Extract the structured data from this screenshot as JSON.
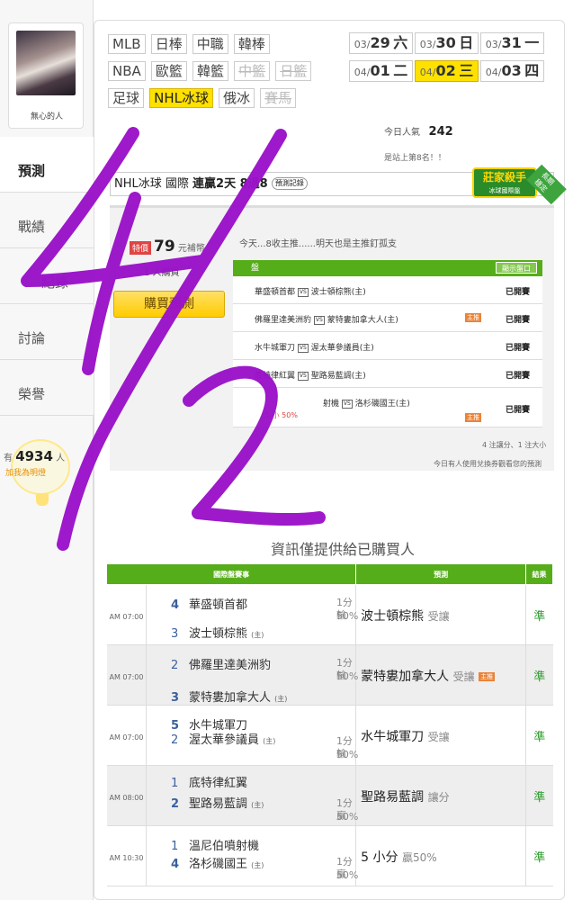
{
  "sidebar": {
    "username": "無心的人",
    "menu": [
      "預測",
      "戰績",
      "紀錄",
      "討論",
      "榮譽"
    ],
    "counter_prefix": "有",
    "counter_value": "4934",
    "counter_unit": "人",
    "counter_sub": "加我為明燈"
  },
  "filters": {
    "row1": [
      "MLB",
      "日棒",
      "中職",
      "韓棒"
    ],
    "row2": [
      "NBA",
      "歐籃",
      "韓籃",
      "中籃",
      "日籃"
    ],
    "row3": [
      "足球",
      "NHL冰球",
      "俄冰",
      "賽馬"
    ]
  },
  "dates": [
    {
      "md": "03/",
      "d": "29",
      "w": "六"
    },
    {
      "md": "03/",
      "d": "30",
      "w": "日"
    },
    {
      "md": "03/",
      "d": "31",
      "w": "一"
    },
    {
      "md": "04/",
      "d": "01",
      "w": "二"
    },
    {
      "md": "04/",
      "d": "02",
      "w": "三"
    },
    {
      "md": "04/",
      "d": "03",
      "w": "四"
    }
  ],
  "popularity": {
    "label": "今日人氣",
    "value": "242",
    "rank": "是站上第8名！！"
  },
  "bar": {
    "prefix": "NHL冰球 國際",
    "streak": "連贏2天 8過8",
    "history": "預測記錄"
  },
  "badge": {
    "title": "莊家殺手",
    "sub": "冰球國際盤",
    "ribbon": "長期穩定"
  },
  "prediction": {
    "hot": "特價",
    "price": "79",
    "price_unit": "元補幣",
    "buyers": "1 人購買",
    "buy_button": "購買預測",
    "note": "今天...8收主推......明天也是主推釘孤支",
    "mini_head": "盤",
    "show_btn": "顯示盤口",
    "games": [
      {
        "match": "華盛頓首都",
        "vs": "VS",
        "opp": "波士頓棕熊(主)",
        "status": "已開賽"
      },
      {
        "match": "佛羅里達美洲豹",
        "vs": "VS",
        "opp": "蒙特婁加拿大人(主)",
        "status": "已開賽",
        "label": "主推"
      },
      {
        "match": "水牛城軍刀",
        "vs": "VS",
        "opp": "渥太華參議員(主)",
        "status": "已開賽"
      },
      {
        "match": "底特律紅翼",
        "vs": "VS",
        "opp": "聖路易藍調(主)",
        "status": "已開賽"
      },
      {
        "match": "射機",
        "vs": "VS",
        "opp": "洛杉磯國王(主)",
        "status": "已開賽",
        "small": "5 小 50%",
        "label": "主推"
      }
    ],
    "summary": "4 注讓分、1 注大小",
    "notice": "今日有人使用兌換券觀看您的預測"
  },
  "info_only": "資訊僅提供給已購買人",
  "table": {
    "headers": [
      "國際盤賽事",
      "預測",
      "結果"
    ],
    "rows": [
      {
        "time": "AM 07:00",
        "s1": "4",
        "t1": "華盛頓首都",
        "s2": "3",
        "t2": "波士頓棕熊",
        "h": "(主)",
        "odds1": "1分輸",
        "odds2": "50%",
        "pick": "波士頓棕熊",
        "pick_sub": "受讓",
        "result": "準",
        "bold": 1
      },
      {
        "time": "AM 07:00",
        "s1": "2",
        "t1": "佛羅里達美洲豹",
        "s2": "3",
        "t2": "蒙特婁加拿大人",
        "h": "(主)",
        "odds1": "1分輸",
        "odds2": "50%",
        "pick": "蒙特婁加拿大人",
        "pick_sub": "受讓",
        "pick_tag": "主推",
        "result": "準",
        "bold": 2
      },
      {
        "time": "AM 07:00",
        "s1": "5",
        "t1": "水牛城軍刀",
        "s2": "2",
        "t2": "渥太華參議員",
        "h": "(主)",
        "odds1": "1分輸",
        "odds2": "50%",
        "pick": "水牛城軍刀",
        "pick_sub": "受讓",
        "result": "準",
        "bold": 1
      },
      {
        "time": "AM 08:00",
        "s1": "1",
        "t1": "底特律紅翼",
        "s2": "2",
        "t2": "聖路易藍調",
        "h": "(主)",
        "odds1": "1分贏",
        "odds2": "50%",
        "pick": "聖路易藍調",
        "pick_sub": "讓分",
        "result": "準",
        "bold": 2
      },
      {
        "time": "AM 10:30",
        "s1": "1",
        "t1": "溫尼伯噴射機",
        "s2": "4",
        "t2": "洛杉磯國王",
        "h": "(主)",
        "odds1": "1分贏",
        "odds2": "50%",
        "pick": "5 小分",
        "pick_sub": "贏50%",
        "result": "準",
        "bold": 2
      }
    ]
  },
  "colors": {
    "green": "#56ad1a",
    "yellow": "#ffe100",
    "purple": "#9a12c9"
  }
}
